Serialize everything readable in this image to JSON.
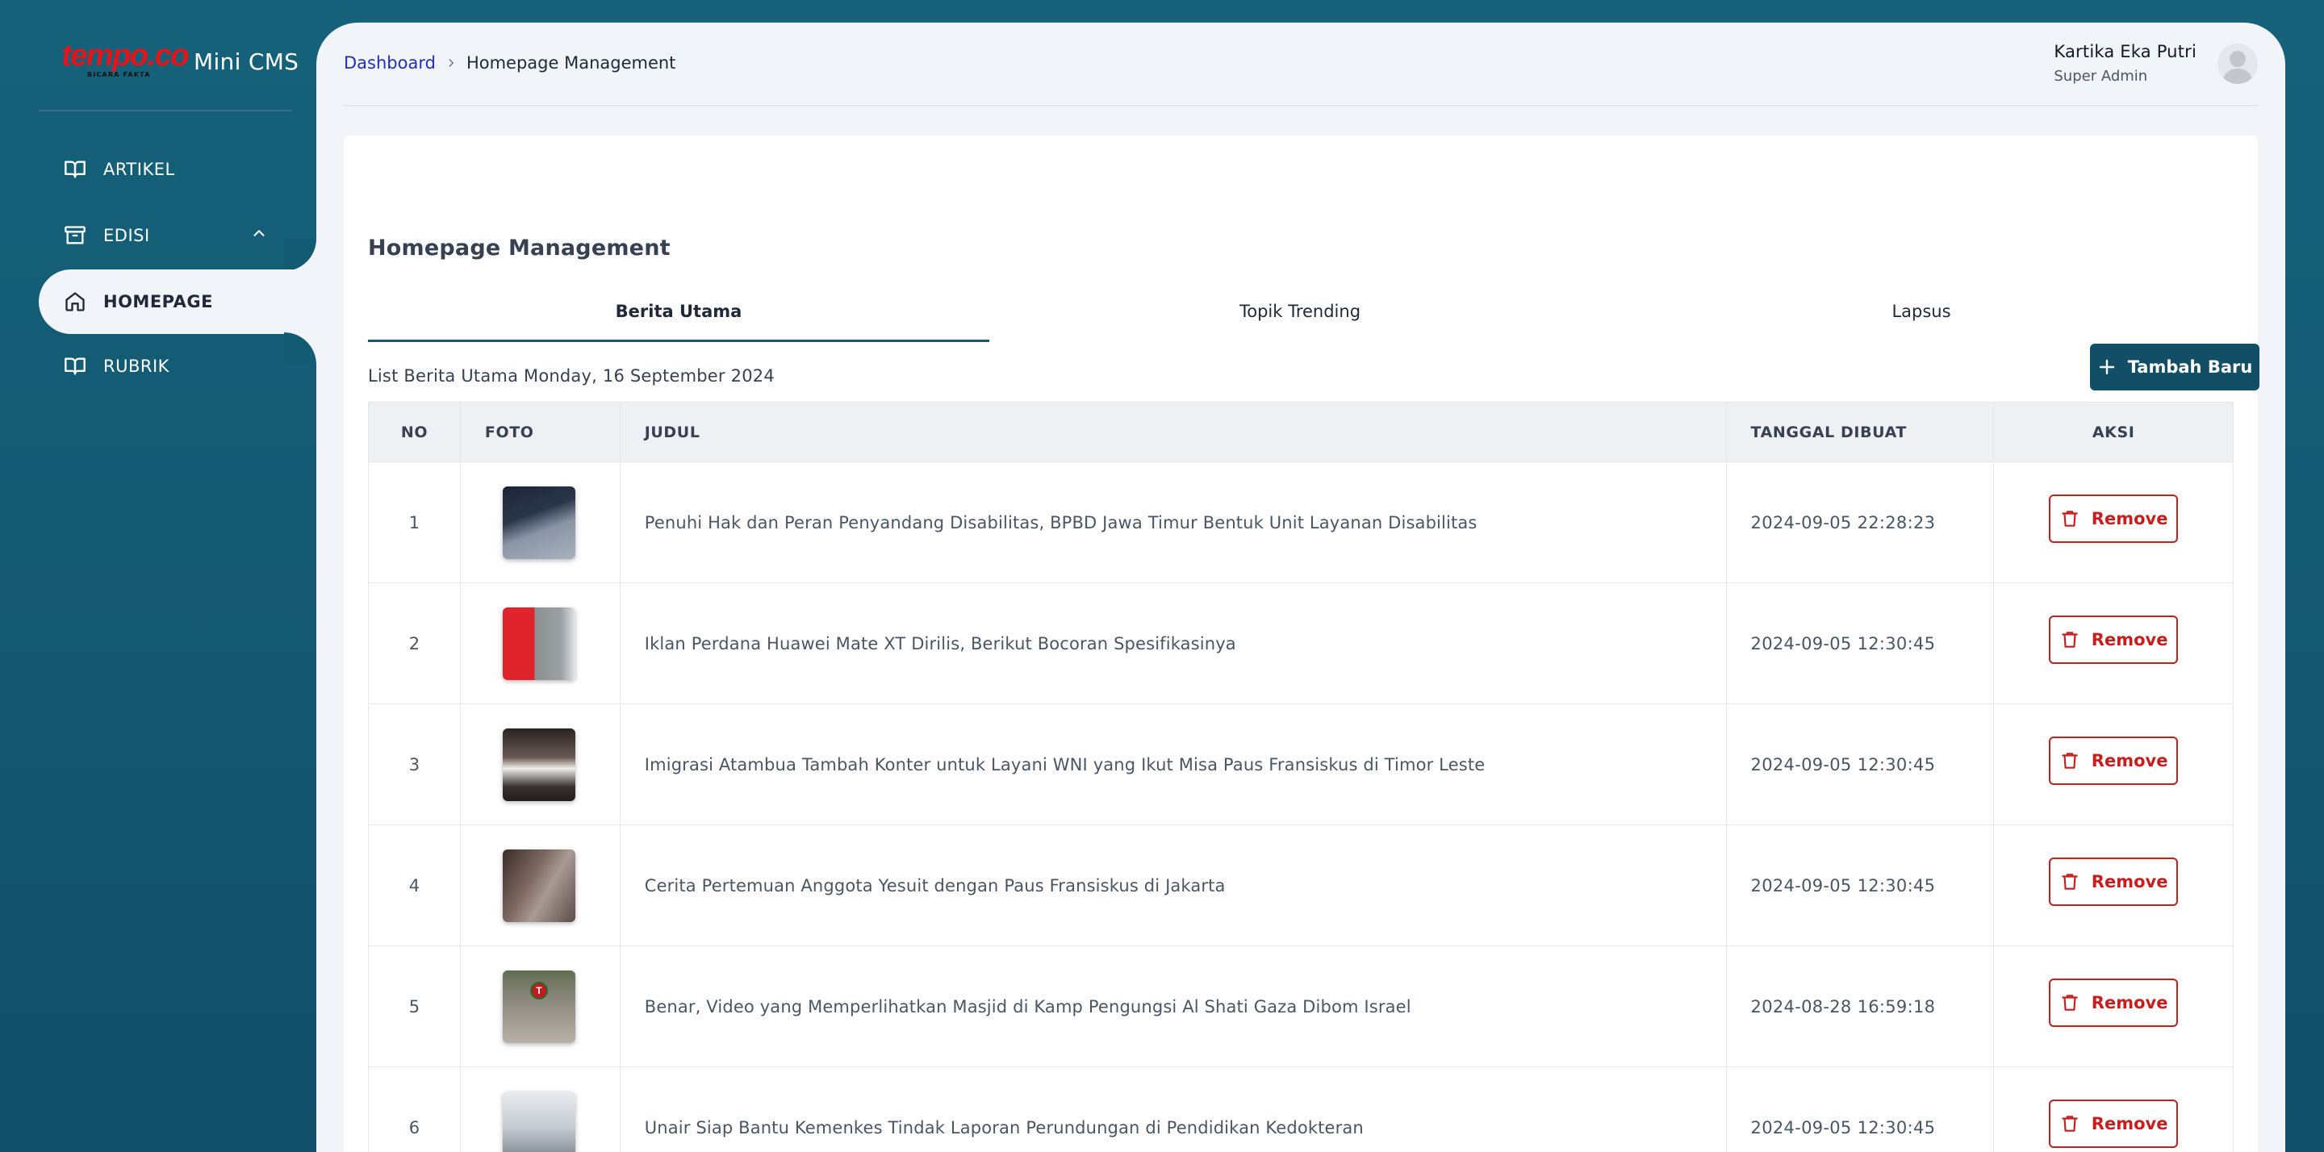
{
  "brand": {
    "logo_text": "tempo.co",
    "logo_tagline": "BICARA FAKTA",
    "app_title": "Mini CMS",
    "logo_color": "#e4141b"
  },
  "sidebar": {
    "items": [
      {
        "label": "ARTIKEL",
        "icon": "book-open-icon"
      },
      {
        "label": "EDISI",
        "icon": "archive-icon",
        "expanded": true
      },
      {
        "label": "HOMEPAGE",
        "icon": "home-icon",
        "active": true
      },
      {
        "label": "RUBRIK",
        "icon": "book-open-icon"
      }
    ]
  },
  "header": {
    "breadcrumb": {
      "root": "Dashboard",
      "current": "Homepage Management"
    },
    "user": {
      "name": "Kartika Eka Putri",
      "role": "Super Admin"
    }
  },
  "main": {
    "title": "Homepage Management",
    "tabs": [
      {
        "label": "Berita Utama",
        "active": true
      },
      {
        "label": "Topik Trending"
      },
      {
        "label": "Lapsus"
      }
    ],
    "list_caption": "List Berita Utama Monday, 16 September 2024",
    "add_button": "Tambah Baru",
    "table": {
      "columns": [
        "NO",
        "FOTO",
        "JUDUL",
        "TANGGAL DIBUAT",
        "AKSI"
      ],
      "remove_label": "Remove",
      "rows": [
        {
          "no": "1",
          "judul": "Penuhi Hak dan Peran Penyandang Disabilitas, BPBD Jawa Timur Bentuk Unit Layanan Disabilitas",
          "tanggal": "2024-09-05 22:28:23"
        },
        {
          "no": "2",
          "judul": "Iklan Perdana Huawei Mate XT Dirilis, Berikut Bocoran Spesifikasinya",
          "tanggal": "2024-09-05 12:30:45"
        },
        {
          "no": "3",
          "judul": "Imigrasi Atambua Tambah Konter untuk Layani WNI yang Ikut Misa Paus Fransiskus di Timor Leste",
          "tanggal": "2024-09-05 12:30:45"
        },
        {
          "no": "4",
          "judul": "Cerita Pertemuan Anggota Yesuit dengan Paus Fransiskus di Jakarta",
          "tanggal": "2024-09-05 12:30:45"
        },
        {
          "no": "5",
          "judul": "Benar, Video yang Memperlihatkan Masjid di Kamp Pengungsi Al Shati Gaza Dibom Israel",
          "tanggal": "2024-08-28 16:59:18"
        },
        {
          "no": "6",
          "judul": "Unair Siap Bantu Kemenkes Tindak Laporan Perundungan di Pendidikan Kedokteran",
          "tanggal": "2024-09-05 12:30:45"
        }
      ]
    }
  },
  "colors": {
    "sidebar_bg": "#15627a",
    "primary_button": "#124f66",
    "danger": "#c81e1e",
    "link": "#2130b9",
    "content_bg": "#f1f5f9"
  },
  "icons": {
    "breadcrumb_separator": "chevron-right-icon",
    "add": "plus-icon",
    "remove": "trash-icon",
    "user": "avatar-icon",
    "submenu_toggle": "chevron-up-icon"
  }
}
